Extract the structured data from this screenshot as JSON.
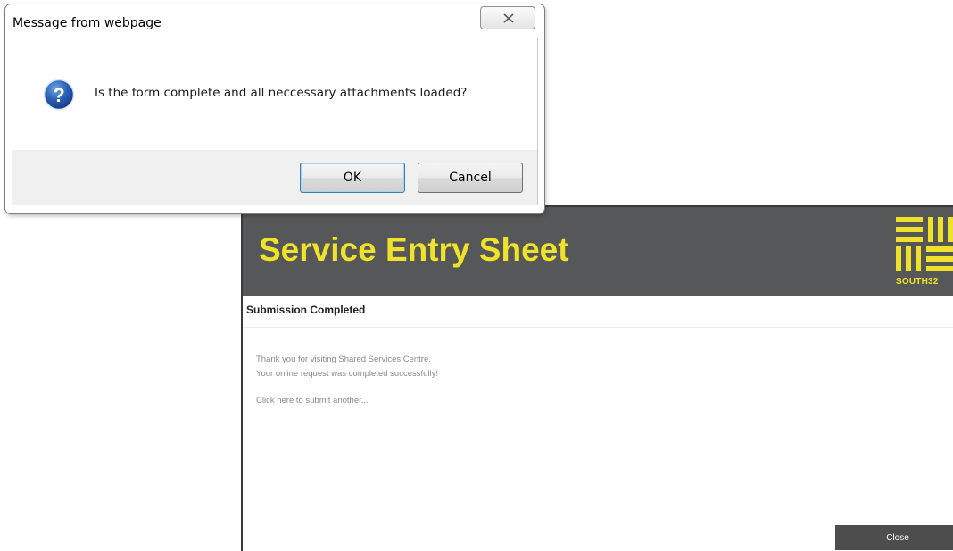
{
  "dialog": {
    "title": "Message from webpage",
    "message": "Is the form complete and all neccessary attachments loaded?",
    "icon": "question-icon",
    "ok_label": "OK",
    "cancel_label": "Cancel"
  },
  "sheet": {
    "title": "Service Entry Sheet",
    "logo_text": "SOUTH32",
    "subheader": "Submission Completed",
    "lines": [
      "Thank you for visiting Shared Services Centre.",
      "Your online request was completed successfully!"
    ],
    "link_text": "Click here to submit another...",
    "close_label": "Close"
  },
  "colors": {
    "header_bg": "#555759",
    "brand_yellow": "#f0e22a",
    "close_button_bg": "#4d4d4d"
  }
}
